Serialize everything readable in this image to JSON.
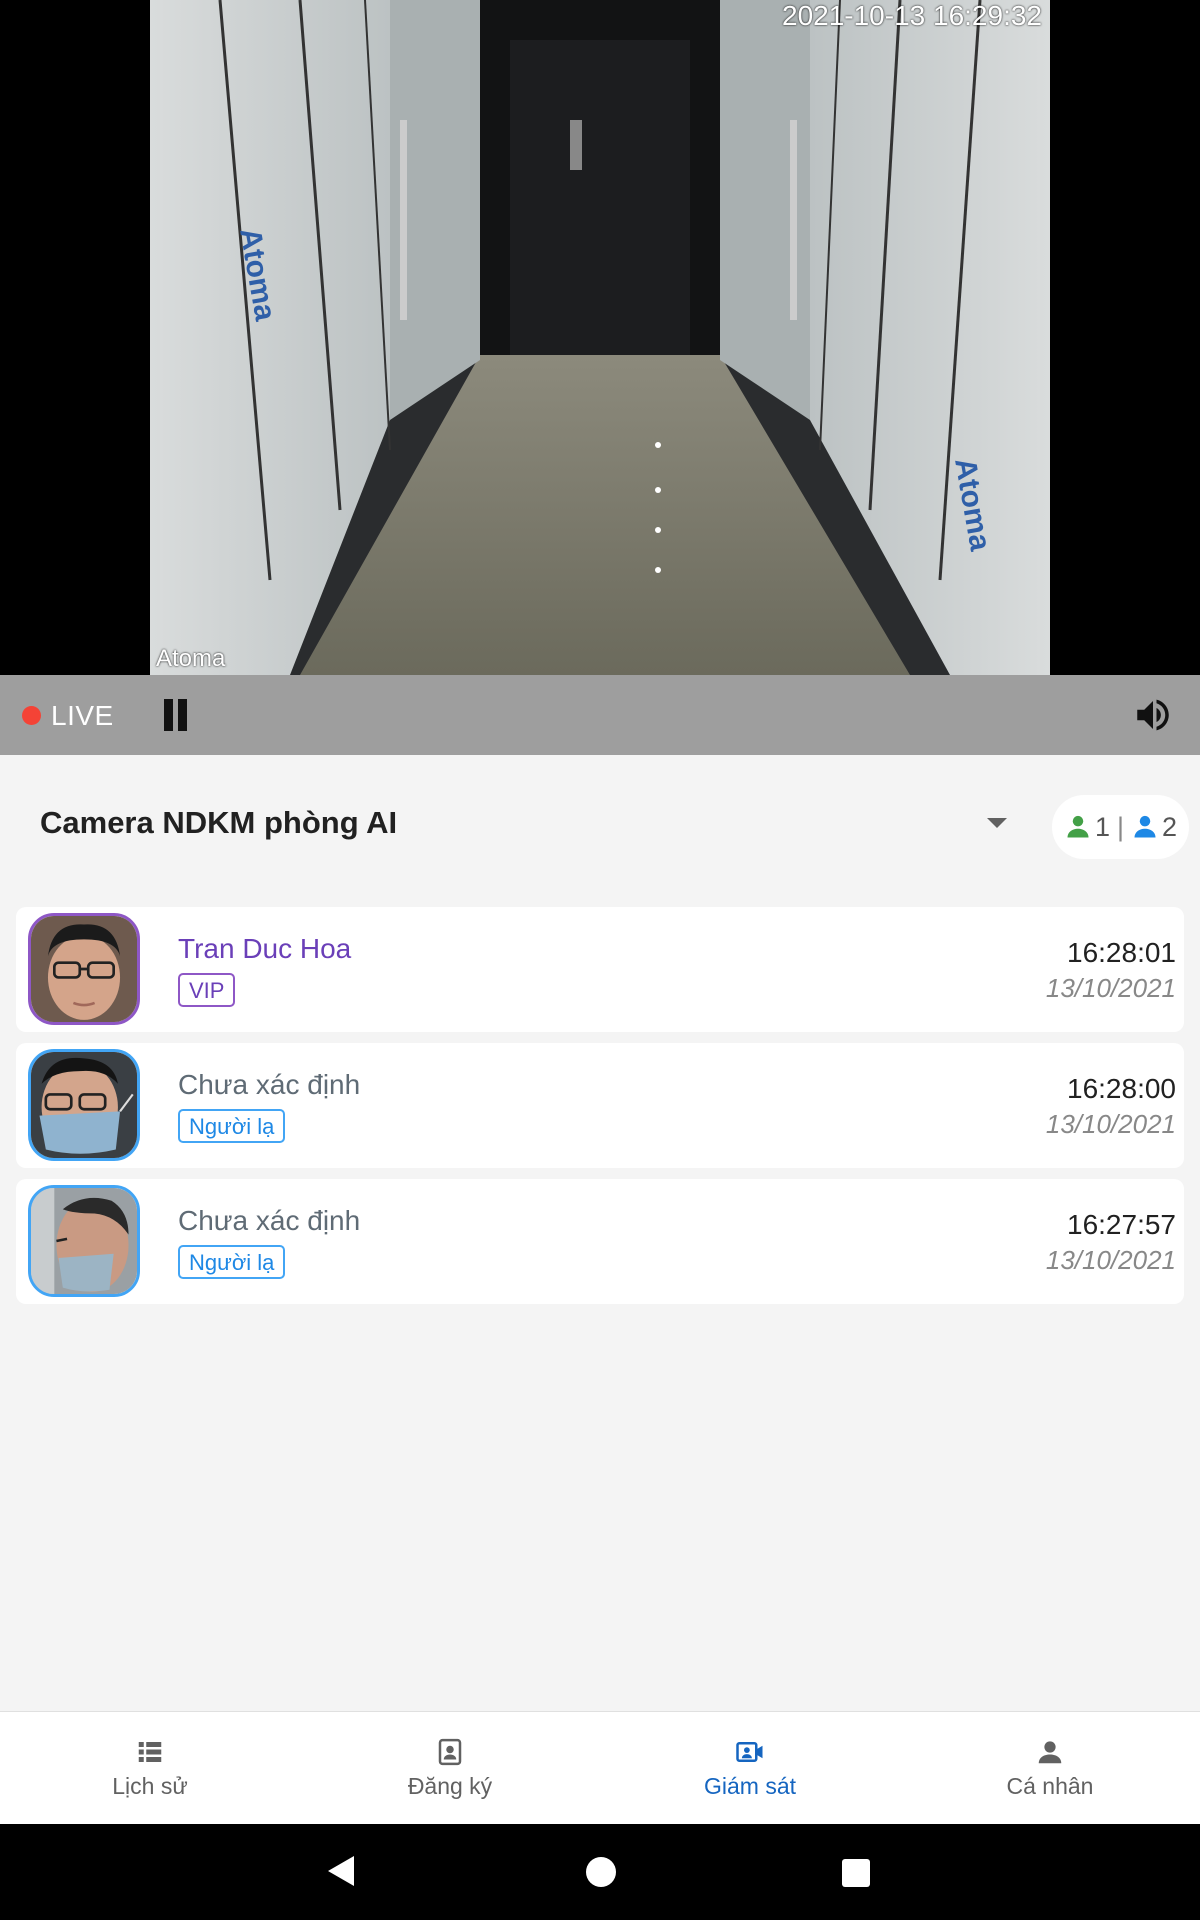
{
  "video": {
    "timestamp": "2021-10-13 16:29:32",
    "watermark": "Atoma"
  },
  "player": {
    "live_label": "LIVE",
    "pause_icon": "pause-icon",
    "volume_icon": "volume-icon"
  },
  "camera": {
    "name": "Camera NDKM phòng AI",
    "known_count": "1",
    "separator": "|",
    "stranger_count": "2"
  },
  "events": [
    {
      "name": "Tran Duc Hoa",
      "tag": "VIP",
      "time": "16:28:01",
      "date": "13/10/2021",
      "kind": "vip"
    },
    {
      "name": "Chưa xác định",
      "tag": "Người lạ",
      "time": "16:28:00",
      "date": "13/10/2021",
      "kind": "stranger"
    },
    {
      "name": "Chưa xác định",
      "tag": "Người lạ",
      "time": "16:27:57",
      "date": "13/10/2021",
      "kind": "stranger"
    }
  ],
  "nav": {
    "items": [
      {
        "label": "Lịch sử",
        "icon": "list-icon"
      },
      {
        "label": "Đăng ký",
        "icon": "contact-card-icon"
      },
      {
        "label": "Giám sát",
        "icon": "video-person-icon",
        "active": true
      },
      {
        "label": "Cá nhân",
        "icon": "person-icon"
      }
    ]
  },
  "colors": {
    "live": "#f44336",
    "vip": "#6a3fb8",
    "stranger": "#1e88e5",
    "nav_active": "#1565c0",
    "known_person": "#43a047",
    "stranger_person": "#1e88e5"
  }
}
